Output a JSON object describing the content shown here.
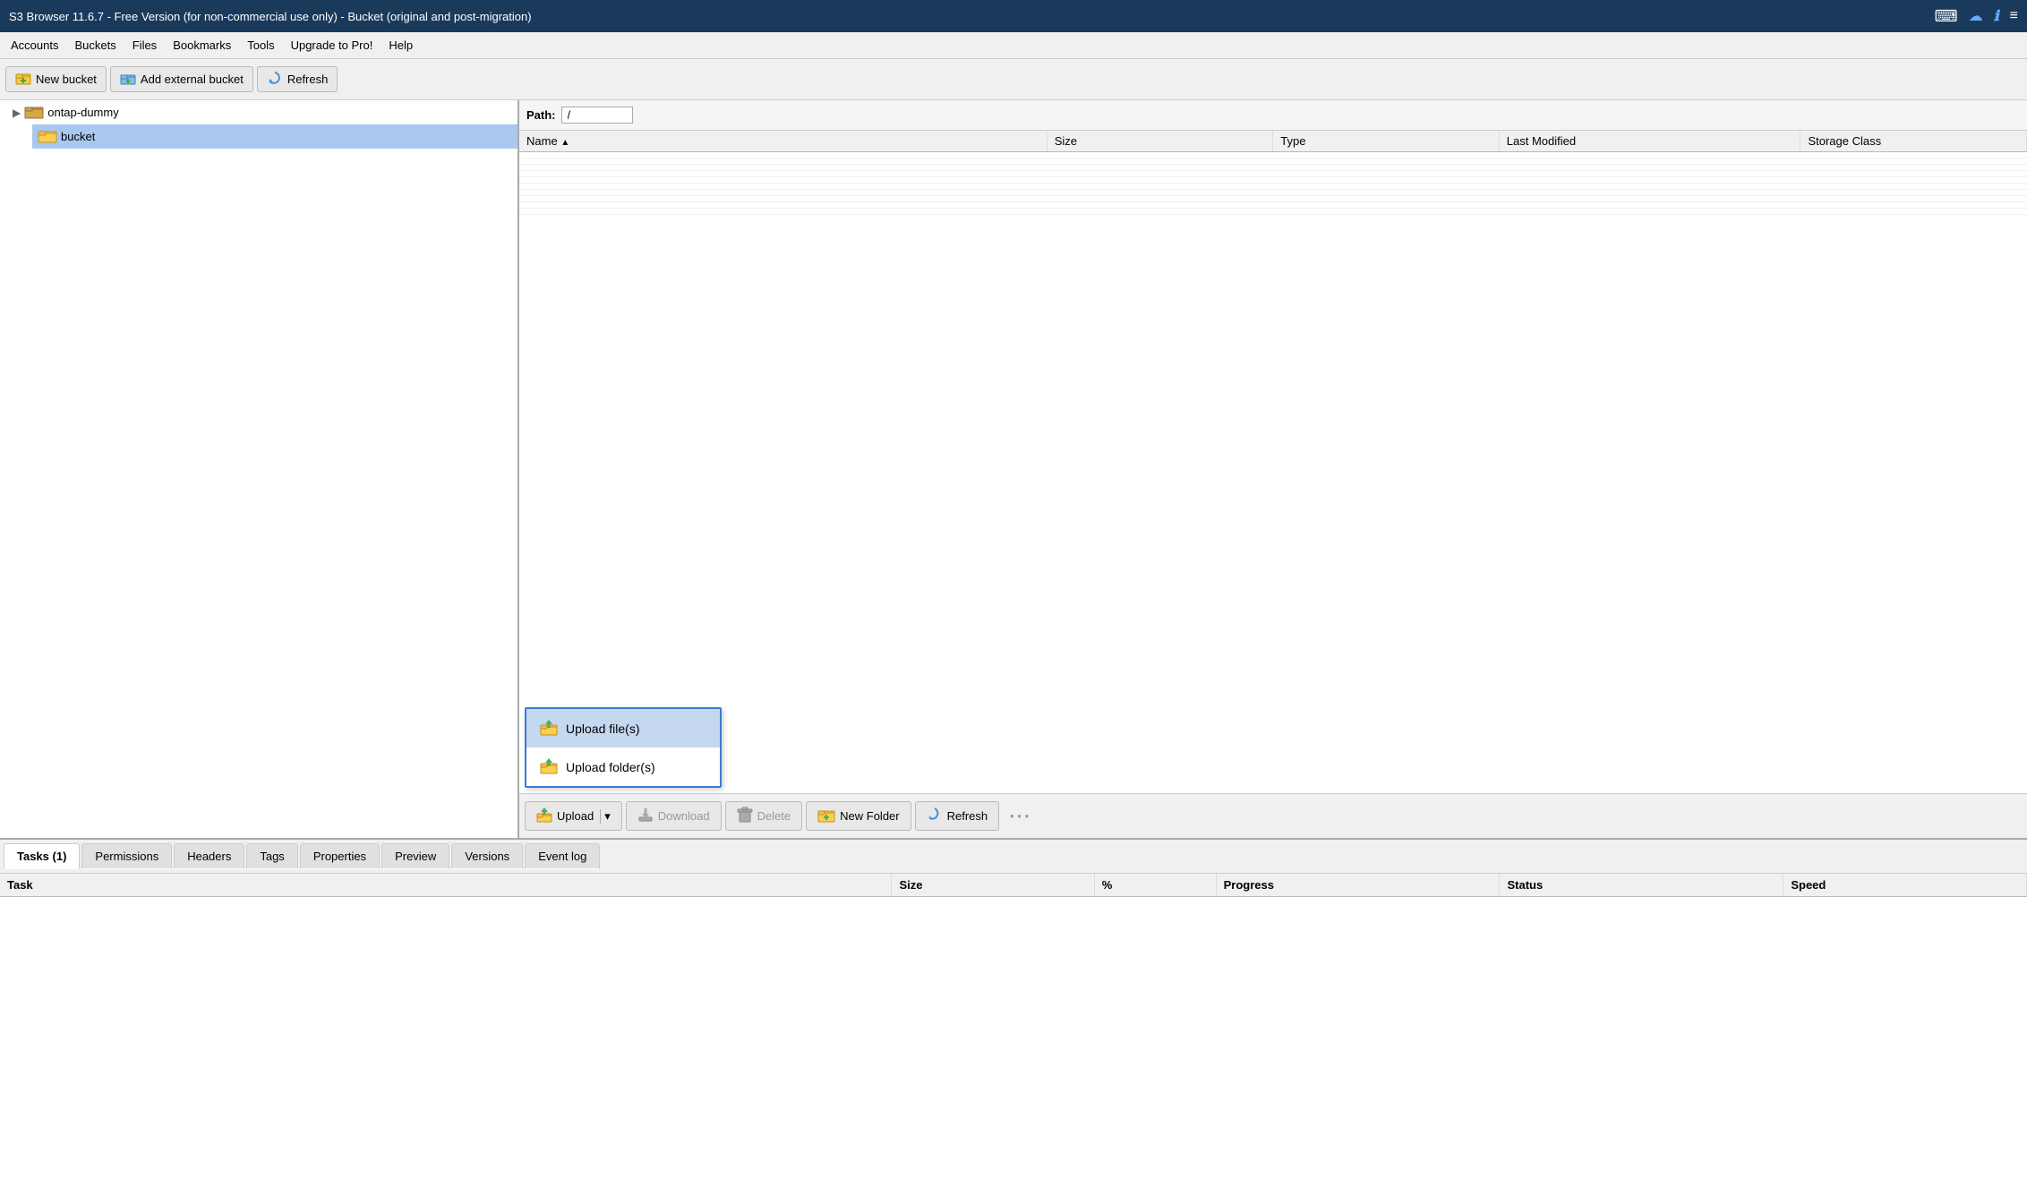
{
  "title_bar": {
    "text": "S3 Browser 11.6.7 - Free Version (for non-commercial use only) - Bucket (original and post-migration)"
  },
  "menu": {
    "items": [
      "Accounts",
      "Buckets",
      "Files",
      "Bookmarks",
      "Tools",
      "Upgrade to Pro!",
      "Help"
    ]
  },
  "toolbar": {
    "new_bucket": "New bucket",
    "add_external": "Add external bucket",
    "refresh": "Refresh"
  },
  "tree": {
    "root": "ontap-dummy",
    "child": "bucket"
  },
  "path_bar": {
    "label": "Path:",
    "value": "/"
  },
  "file_table": {
    "columns": [
      "Name",
      "Size",
      "Type",
      "Last Modified",
      "Storage Class"
    ]
  },
  "bottom_toolbar": {
    "upload": "Upload",
    "download": "Download",
    "delete": "Delete",
    "new_folder": "New Folder",
    "refresh": "Refresh"
  },
  "context_menu": {
    "items": [
      {
        "label": "Upload file(s)",
        "highlighted": true
      },
      {
        "label": "Upload folder(s)",
        "highlighted": false
      }
    ]
  },
  "tabs": {
    "items": [
      "Tasks (1)",
      "Permissions",
      "Headers",
      "Tags",
      "Properties",
      "Preview",
      "Versions",
      "Event log"
    ],
    "active": 0
  },
  "tasks_table": {
    "columns": [
      "Task",
      "Size",
      "%",
      "Progress",
      "Status",
      "Speed"
    ]
  },
  "colors": {
    "accent": "#3a7bd5",
    "folder_yellow": "#f5a623",
    "folder_orange": "#e8820c",
    "selected_bg": "#a8c8f0",
    "highlight_bg": "#c4d8f0"
  }
}
